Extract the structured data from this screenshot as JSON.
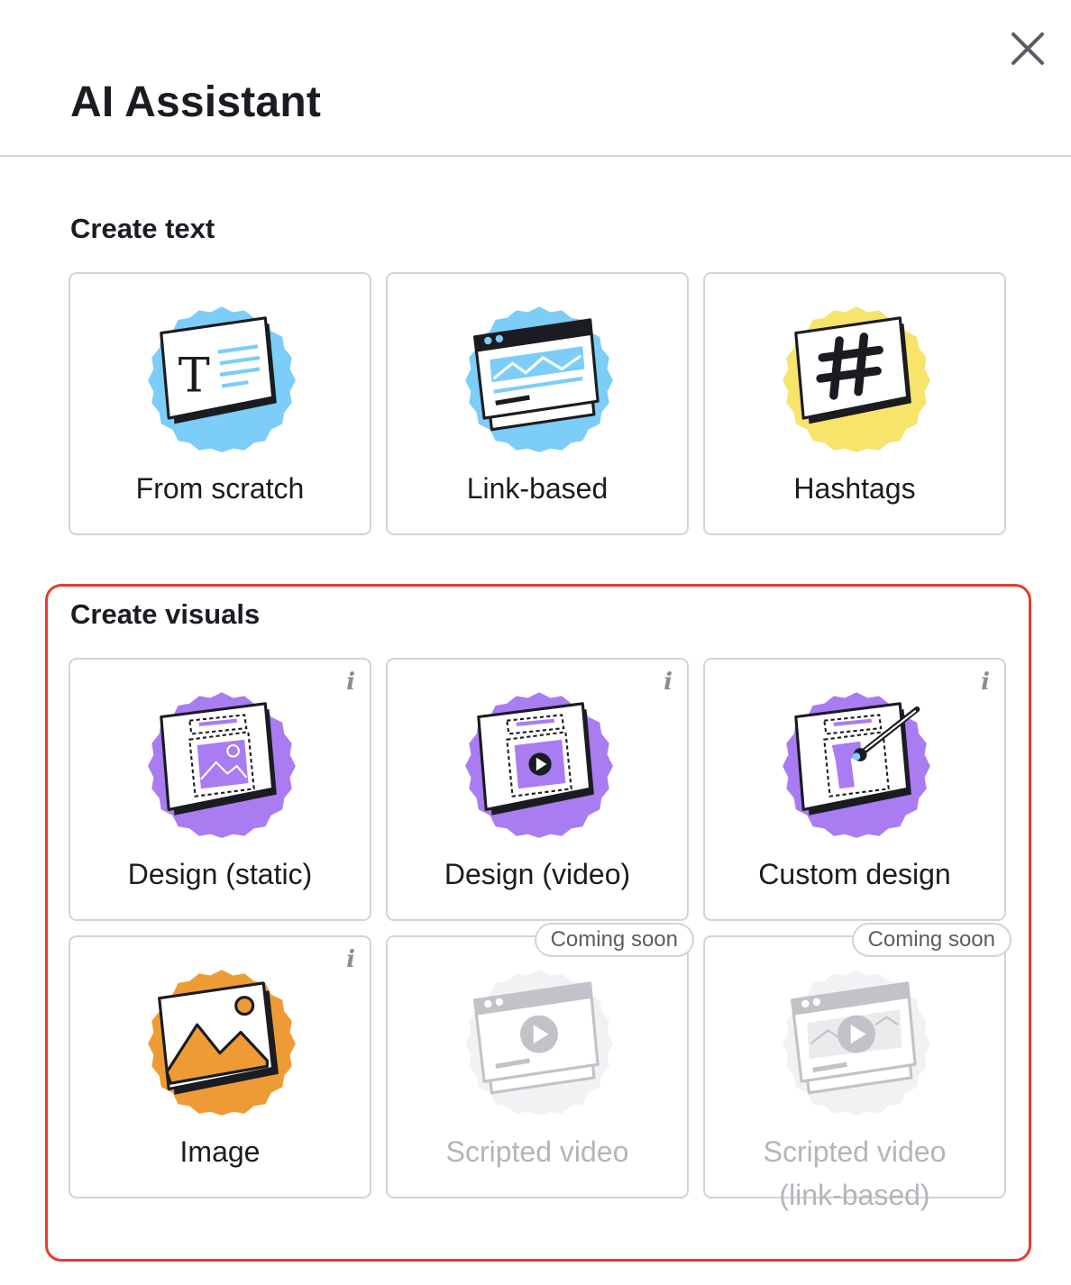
{
  "header": {
    "title": "AI Assistant"
  },
  "create_text": {
    "heading": "Create text",
    "cards": [
      {
        "label": "From scratch"
      },
      {
        "label": "Link-based"
      },
      {
        "label": "Hashtags"
      }
    ]
  },
  "create_visuals": {
    "heading": "Create visuals",
    "info_glyph": "i",
    "cards": [
      {
        "label": "Design (static)"
      },
      {
        "label": "Design (video)"
      },
      {
        "label": "Custom design"
      },
      {
        "label": "Image"
      },
      {
        "label": "Scripted video",
        "badge": "Coming soon"
      },
      {
        "label_line1": "Scripted video",
        "label_line2": "(link-based)",
        "badge": "Coming soon"
      }
    ]
  },
  "colors": {
    "blue_blob": "#7ccdf7",
    "yellow_blob": "#f8e36b",
    "purple_blob": "#a97cf2",
    "orange_blob": "#ef9b35",
    "highlight_frame": "#e63b2e",
    "disabled_text": "#b4b5bb"
  },
  "icons": [
    "close-icon",
    "text-doc-icon",
    "browser-link-icon",
    "hashtag-icon",
    "design-static-icon",
    "design-video-icon",
    "custom-design-icon",
    "image-icon",
    "scripted-video-icon",
    "scripted-video-link-icon",
    "info-icon"
  ]
}
